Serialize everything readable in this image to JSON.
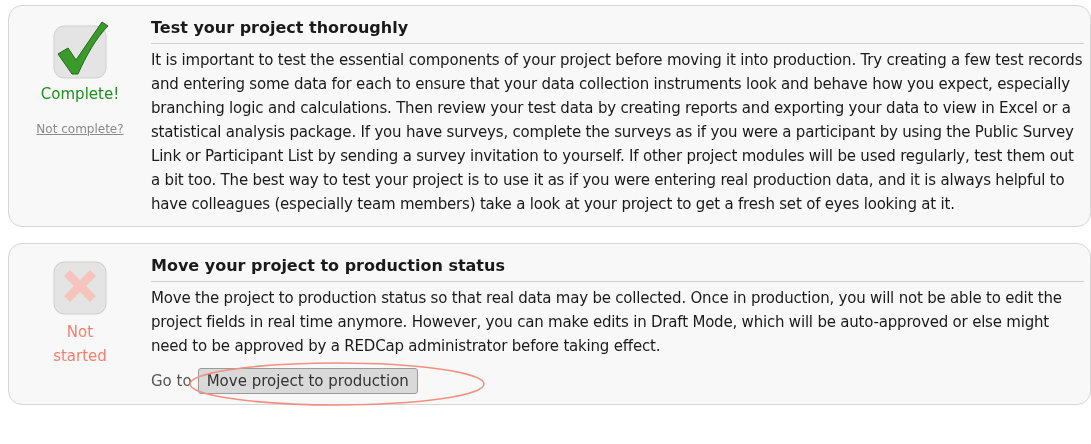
{
  "steps": [
    {
      "kind": "complete",
      "status_label": "Complete!",
      "undo_link": "Not complete?",
      "title": "Test your project thoroughly",
      "description": "It is important to test the essential components of your project before moving it into production. Try creating a few test records and entering some data for each to ensure that your data collection instruments look and behave how you expect, especially branching logic and calculations. Then review your test data by creating reports and exporting your data to view in Excel or a statistical analysis package. If you have surveys, complete the surveys as if you were a participant by using the Public Survey Link or Participant List by sending a survey invitation to yourself. If other project modules will be used regularly, test them out a bit too. The best way to test your project is to use it as if you were entering real production data, and it is always helpful to have colleagues (especially team members) take a look at your project to get a fresh set of eyes looking at it."
    },
    {
      "kind": "not_started",
      "status_label": "Not started",
      "title": "Move your project to production status",
      "description": "Move the project to production status so that real data may be collected. Once in production, you will not be able to edit the project fields in real time anymore. However, you can make edits in Draft Mode, which will be auto-approved or else might need to be approved by a REDCap administrator before taking effect.",
      "action": {
        "prefix": "Go to",
        "button": "Move project to production",
        "highlighted": true
      }
    }
  ]
}
